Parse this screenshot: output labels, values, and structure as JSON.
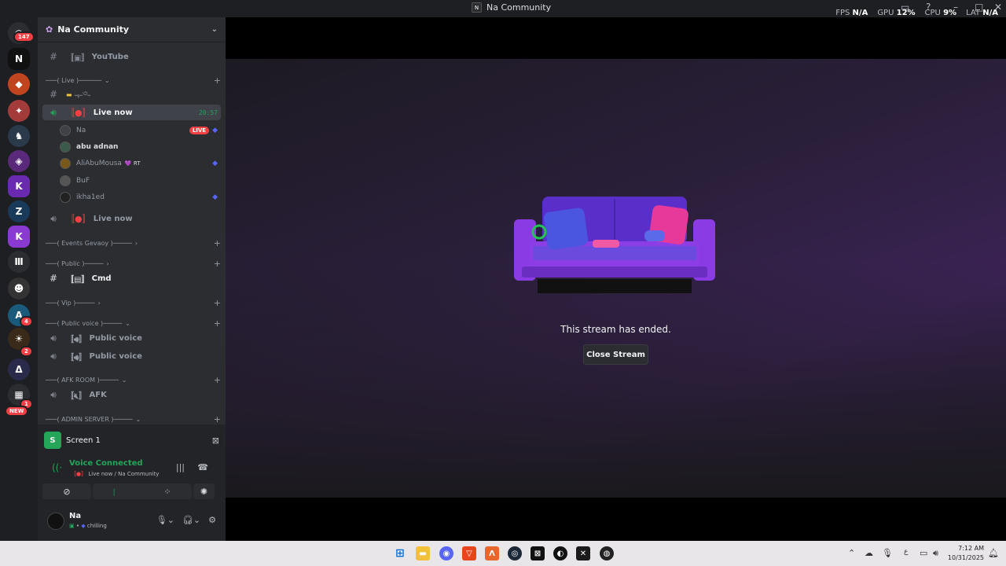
{
  "window": {
    "title": "Na Community",
    "stats": [
      {
        "label": "FPS",
        "value": "N/A"
      },
      {
        "label": "GPU",
        "value": "12%"
      },
      {
        "label": "CPU",
        "value": "9%"
      },
      {
        "label": "LAT",
        "value": "N/A"
      }
    ]
  },
  "rail": {
    "home_badge": "147",
    "badge_4": "4",
    "badge_2": "2",
    "badge_1": "1",
    "new_label": "NEW"
  },
  "sidebar": {
    "server_name": "Na Community",
    "channels": {
      "youtube": "YouTube",
      "cat_live": "───( Live )──────",
      "arabic": "ـﮩـ৩ـ",
      "live_now_1": "Live now",
      "live_time": "20:57",
      "live_now_2": "Live now",
      "cat_events": "───( Events Gevaoy )─────",
      "cat_public": "───( Public )─────",
      "cmd": "Cmd",
      "cat_vip": "───( Vip )─────",
      "cat_public_voice": "───( Public voice )─────",
      "public_voice_1": "Public voice",
      "public_voice_2": "Public voice",
      "cat_afk": "───( AFK ROOM )─────",
      "afk": "AFK",
      "cat_admin": "───( ADMIN SERVER )─────"
    },
    "users": [
      {
        "name": "Na",
        "badge": "LIVE"
      },
      {
        "name": "abu adnan"
      },
      {
        "name": "AliAbuMousa",
        "tag": "RT"
      },
      {
        "name": "BuF"
      },
      {
        "name": "ikha1ed"
      }
    ]
  },
  "panel": {
    "screen_label": "Screen 1",
    "voice_title": "Voice Connected",
    "voice_sub": "Live now / Na Community",
    "user_name": "Na",
    "user_status": "chilling"
  },
  "main": {
    "ended_text": "This stream has ended.",
    "close_label": "Close Stream"
  },
  "taskbar": {
    "time": "7:12 AM",
    "date": "10/31/2025",
    "lang": "ع"
  }
}
